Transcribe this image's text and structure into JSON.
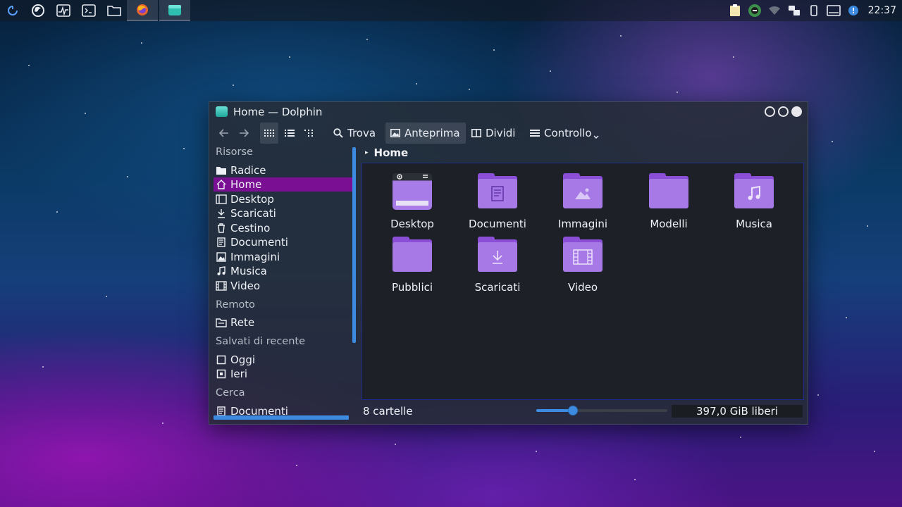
{
  "panel": {
    "launchers": [
      {
        "icon": "plasma-launcher-icon"
      },
      {
        "icon": "firefox-launcher-icon"
      },
      {
        "icon": "system-monitor-icon"
      },
      {
        "icon": "terminal-icon"
      },
      {
        "icon": "folder-launcher-icon"
      }
    ],
    "tasks": [
      {
        "icon": "firefox-task-icon"
      },
      {
        "icon": "dolphin-task-icon"
      }
    ],
    "tray": [
      "clipboard-icon",
      "update-icon",
      "network-wifi-icon",
      "kdeconnect-icon",
      "phone-icon",
      "display-icon",
      "notification-icon"
    ],
    "clock": "22:37"
  },
  "window": {
    "title": "Home — Dolphin",
    "toolbar": {
      "find": "Trova",
      "preview": "Anteprima",
      "split": "Dividi",
      "control": "Controllo"
    },
    "sidebar": {
      "sections": {
        "places": "Risorse",
        "remote": "Remoto",
        "recent": "Salvati di recente",
        "search": "Cerca"
      },
      "places": [
        {
          "label": "Radice",
          "icon": "drive-icon"
        },
        {
          "label": "Home",
          "icon": "home-icon",
          "selected": true
        },
        {
          "label": "Desktop",
          "icon": "desktop-icon"
        },
        {
          "label": "Scaricati",
          "icon": "download-icon"
        },
        {
          "label": "Cestino",
          "icon": "trash-icon"
        },
        {
          "label": "Documenti",
          "icon": "document-icon"
        },
        {
          "label": "Immagini",
          "icon": "image-icon"
        },
        {
          "label": "Musica",
          "icon": "music-icon"
        },
        {
          "label": "Video",
          "icon": "video-icon"
        }
      ],
      "remote": [
        {
          "label": "Rete",
          "icon": "network-icon"
        }
      ],
      "recent": [
        {
          "label": "Oggi",
          "icon": "calendar-today-icon"
        },
        {
          "label": "Ieri",
          "icon": "calendar-yesterday-icon"
        }
      ],
      "search": [
        {
          "label": "Documenti",
          "icon": "document-icon"
        }
      ]
    },
    "breadcrumb": "Home",
    "items": [
      {
        "label": "Desktop",
        "icon": "desktop-folder-icon"
      },
      {
        "label": "Documenti",
        "icon": "documents-folder-icon"
      },
      {
        "label": "Immagini",
        "icon": "pictures-folder-icon"
      },
      {
        "label": "Modelli",
        "icon": "templates-folder-icon"
      },
      {
        "label": "Musica",
        "icon": "music-folder-icon"
      },
      {
        "label": "Pubblici",
        "icon": "public-folder-icon"
      },
      {
        "label": "Scaricati",
        "icon": "downloads-folder-icon"
      },
      {
        "label": "Video",
        "icon": "videos-folder-icon"
      }
    ],
    "status": {
      "count": "8 cartelle",
      "zoom_level": 0.28,
      "free_space": "397,0 GiB liberi"
    },
    "colors": {
      "accent": "#3d8be0",
      "selection": "#7a0f94",
      "folder": "#a679e6"
    }
  }
}
